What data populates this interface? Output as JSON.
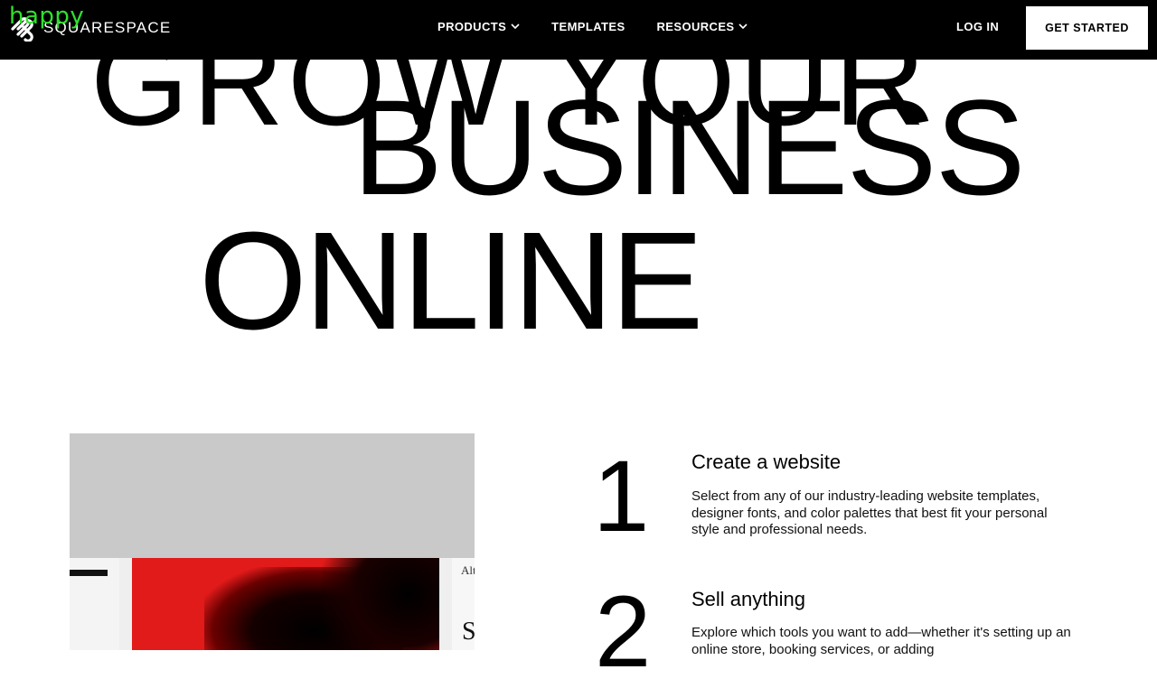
{
  "watermark": "happy",
  "header": {
    "logo_text": "SQUARESPACE",
    "nav": [
      {
        "label": "PRODUCTS",
        "has_dropdown": true
      },
      {
        "label": "TEMPLATES",
        "has_dropdown": false
      },
      {
        "label": "RESOURCES",
        "has_dropdown": true
      }
    ],
    "login_label": "LOG IN",
    "cta_label": "GET STARTED"
  },
  "hero": {
    "clipped_text": "GROW YOUR",
    "line1": "BUSINESS",
    "line2": "ONLINE"
  },
  "preview": {
    "right_text_top": "Alt",
    "right_text_bottom": "S"
  },
  "steps": [
    {
      "number": "1",
      "title": "Create a website",
      "description": "Select from any of our industry-leading website templates, designer fonts, and color palettes that best fit your personal style and professional needs."
    },
    {
      "number": "2",
      "title": "Sell anything",
      "description": "Explore which tools you want to add—whether it's setting up an online store, booking services, or adding"
    }
  ],
  "colors": {
    "header_bg": "#000000",
    "watermark": "#2ee02e",
    "preview_red": "#e11a1a"
  }
}
